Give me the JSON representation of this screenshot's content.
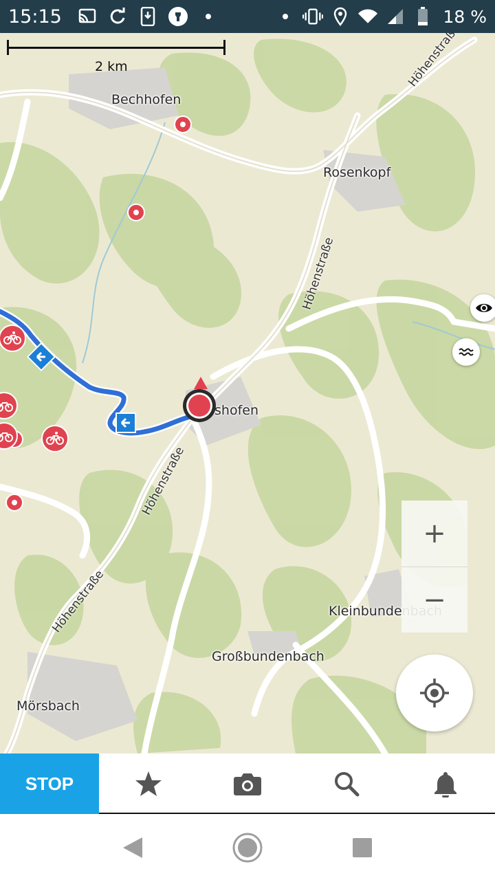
{
  "status_bar": {
    "time": "15:15",
    "battery": "18 %",
    "icons_left": [
      "cast-icon",
      "sync-icon",
      "screenshot-icon",
      "flashlight-icon",
      "dot-icon"
    ],
    "icons_right": [
      "dot-icon",
      "vibrate-icon",
      "location-icon",
      "wifi-icon",
      "signal-icon",
      "battery-icon"
    ]
  },
  "map": {
    "scale_label": "2 km",
    "places": {
      "bechhofen": "Bechhofen",
      "rosenkopf": "Rosenkopf",
      "current_town": "shofen",
      "kleinbundenbach": "Kleinbundenbach",
      "grossbundenbach": "Großbundenbach",
      "moersbach": "Mörsbach"
    },
    "roads": {
      "hoehenstrasse_1": "Höhenstraße",
      "hoehenstrasse_2": "Höhenstraße",
      "hoehenstrasse_3": "Höhenstraße",
      "hoehenstrasse_4": "Höhenstraße"
    },
    "colors": {
      "route": "#2f6fd6",
      "poi": "#e0434f",
      "forest": "#c7d7a1",
      "background": "#ece9d3"
    }
  },
  "zoom": {
    "in": "+",
    "out": "−"
  },
  "toolbar": {
    "stop_label": "STOP",
    "buttons": [
      "star-icon",
      "camera-icon",
      "search-icon",
      "bell-icon"
    ]
  },
  "navbar": {
    "buttons": [
      "back-icon",
      "home-icon",
      "recents-icon"
    ]
  }
}
